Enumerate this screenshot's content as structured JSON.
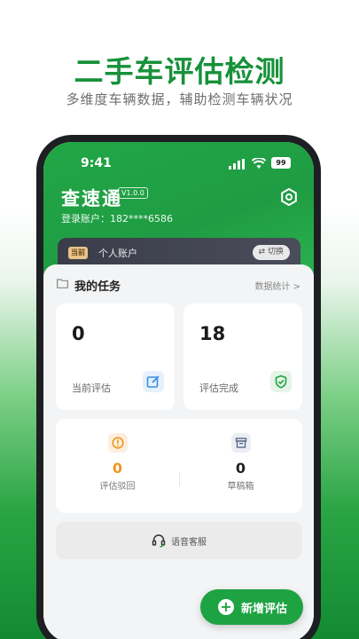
{
  "promo": {
    "title": "二手车评估检测",
    "subtitle": "多维度车辆数据，辅助检测车辆状况"
  },
  "status_bar": {
    "time": "9:41",
    "battery": "99"
  },
  "header": {
    "brand": "查速通",
    "version": "V1.0.0",
    "account_line": "登录账户：182****6586"
  },
  "account_card": {
    "badge": "当前",
    "name": "个人账户",
    "switch_label": "⇄ 切换"
  },
  "tasks": {
    "title": "我的任务",
    "stats_link": "数据统计 >",
    "current": {
      "value": "0",
      "label": "当前评估"
    },
    "completed": {
      "value": "18",
      "label": "评估完成"
    },
    "rejected": {
      "value": "0",
      "label": "评估驳回"
    },
    "drafts": {
      "value": "0",
      "label": "草稿箱"
    }
  },
  "service": {
    "label": "语音客服"
  },
  "fab": {
    "label": "新增评估",
    "plus": "+"
  },
  "colors": {
    "brand_green": "#1ea342",
    "reject_orange": "#f0961e",
    "draft_blue": "#5b6a8c"
  }
}
